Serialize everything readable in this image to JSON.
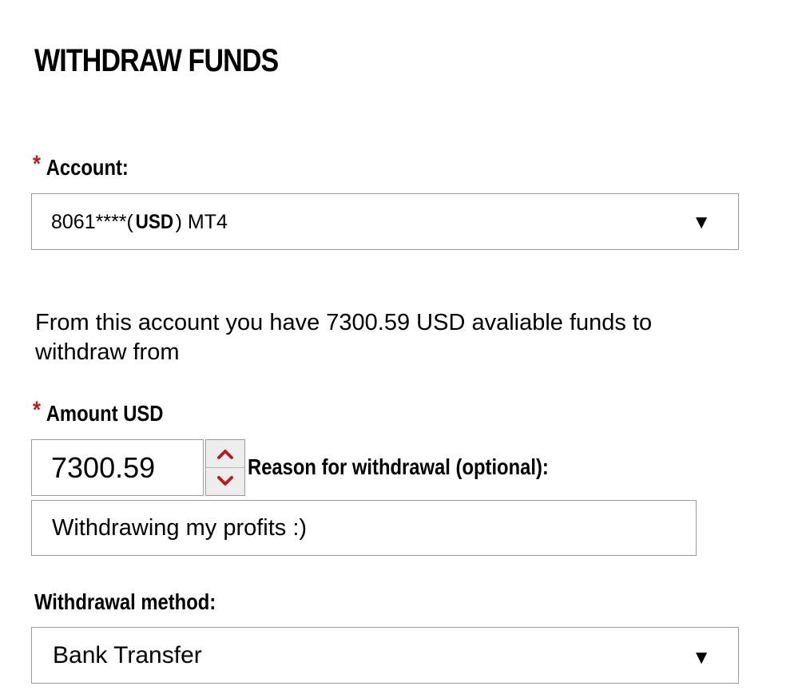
{
  "form": {
    "title": "WITHDRAW FUNDS",
    "required_marker": "*",
    "account": {
      "label": "Account:",
      "value_prefix": "8061****(",
      "value_currency": "USD",
      "value_suffix": ") MT4",
      "arrow": "▼"
    },
    "info_text": "From this account you have 7300.59 USD avaliable funds to withdraw from",
    "amount": {
      "label": "Amount USD",
      "value": "7300.59"
    },
    "reason": {
      "label": "Reason for withdrawal (optional):",
      "value": "Withdrawing my profits :)"
    },
    "method": {
      "label": "Withdrawal method:",
      "value": "Bank Transfer",
      "arrow": "▼"
    }
  },
  "colors": {
    "required_star": "#b21f24",
    "stepper_arrow": "#b21f24",
    "border": "#9a9a9a"
  },
  "icons": {
    "stepper_up": "chevron-up-icon",
    "stepper_down": "chevron-down-icon",
    "select_arrow": "caret-down-icon"
  }
}
